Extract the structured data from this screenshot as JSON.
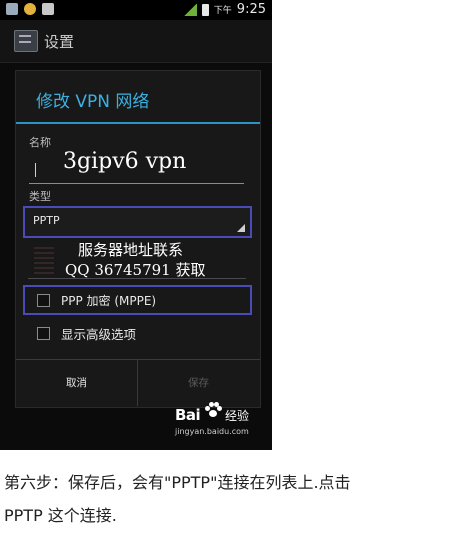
{
  "status_bar": {
    "ampm": "下午",
    "time": "9:25"
  },
  "action_bar": {
    "title": "设置",
    "icon": "settings-icon"
  },
  "dialog": {
    "title": "修改 VPN 网络",
    "name_label": "名称",
    "name_value": "3gipv6 vpn",
    "type_label": "类型",
    "type_value": "PPTP",
    "server_line1": "服务器地址联系",
    "server_line2": "QQ 36745791 获取",
    "ppp_encryption": "PPP 加密 (MPPE)",
    "show_advanced": "显示高级选项",
    "cancel_button": "取消",
    "save_button": "保存"
  },
  "watermark": {
    "logo": "Bai",
    "logo_suffix": "经验",
    "url": "jingyan.baidu.com"
  },
  "caption": {
    "line1": "第六步：保存后，会有\"PPTP\"连接在列表上.点击",
    "line2": "PPTP 这个连接."
  },
  "colors": {
    "accent": "#3bb0e0",
    "highlight_box": "#4a4ab8"
  }
}
